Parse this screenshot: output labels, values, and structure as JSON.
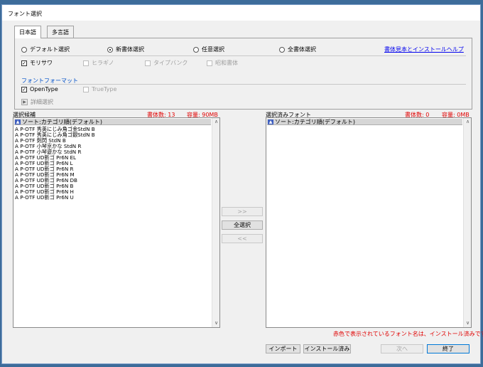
{
  "window": {
    "title": "フォント選択"
  },
  "tabs": [
    {
      "label": "日本語",
      "active": true
    },
    {
      "label": "多言語",
      "active": false
    }
  ],
  "selection_modes": [
    {
      "label": "デフォルト選択",
      "selected": false
    },
    {
      "label": "新書体選択",
      "selected": true
    },
    {
      "label": "任意選択",
      "selected": false
    },
    {
      "label": "全書体選択",
      "selected": false
    }
  ],
  "help_link": "書体見本とインストールヘルプ",
  "makers": [
    {
      "label": "モリサワ",
      "checked": true,
      "enabled": true
    },
    {
      "label": "ヒラギノ",
      "checked": false,
      "enabled": false
    },
    {
      "label": "タイプバンク",
      "checked": false,
      "enabled": false
    },
    {
      "label": "昭和書体",
      "checked": false,
      "enabled": false
    }
  ],
  "font_format": {
    "heading": "フォントフォーマット",
    "options": [
      {
        "label": "OpenType",
        "checked": true,
        "enabled": true
      },
      {
        "label": "TrueType",
        "checked": false,
        "enabled": false
      }
    ]
  },
  "detail_select": {
    "label": "詳細選択",
    "arrow": "▶"
  },
  "candidates": {
    "title": "選択候補",
    "count_text": "書体数: 13",
    "size_text": "容量: 90MB",
    "sort_header": "ソート:カテゴリ順(デフォルト)",
    "items": [
      "A P-OTF 秀英にじみ角ゴ金StdN B",
      "A P-OTF 秀英にじみ角ゴ銀StdN B",
      "A P-OTF 剣閃 StdN B",
      "A P-OTF 小琴京かな StdN R",
      "A P-OTF 小琴遊かな StdN R",
      "A P-OTF UD新ゴ Pr6N EL",
      "A P-OTF UD新ゴ Pr6N L",
      "A P-OTF UD新ゴ Pr6N R",
      "A P-OTF UD新ゴ Pr6N M",
      "A P-OTF UD新ゴ Pr6N DB",
      "A P-OTF UD新ゴ Pr6N B",
      "A P-OTF UD新ゴ Pr6N H",
      "A P-OTF UD新ゴ Pr6N U"
    ]
  },
  "selected": {
    "title": "選択済みフォント",
    "count_text": "書体数: 0",
    "size_text": "容量: 0MB",
    "sort_header": "ソート:カテゴリ順(デフォルト)",
    "items": []
  },
  "transfer": {
    "add_label": ">>",
    "select_all_label": "全選択",
    "remove_label": "<<"
  },
  "installed_note": "赤色で表示されているフォント名は、インストール済みです。",
  "footer": {
    "import_label": "インポート",
    "installed_label": "インストール済み",
    "next_label": "次へ",
    "finish_label": "終了"
  },
  "colors": {
    "installed_red": "#e00000",
    "link_blue": "#0000ee",
    "section_blue": "#0050c8"
  },
  "icons": {
    "scroll_up": "▲",
    "scroll_down": "▼",
    "sort": "▲"
  }
}
